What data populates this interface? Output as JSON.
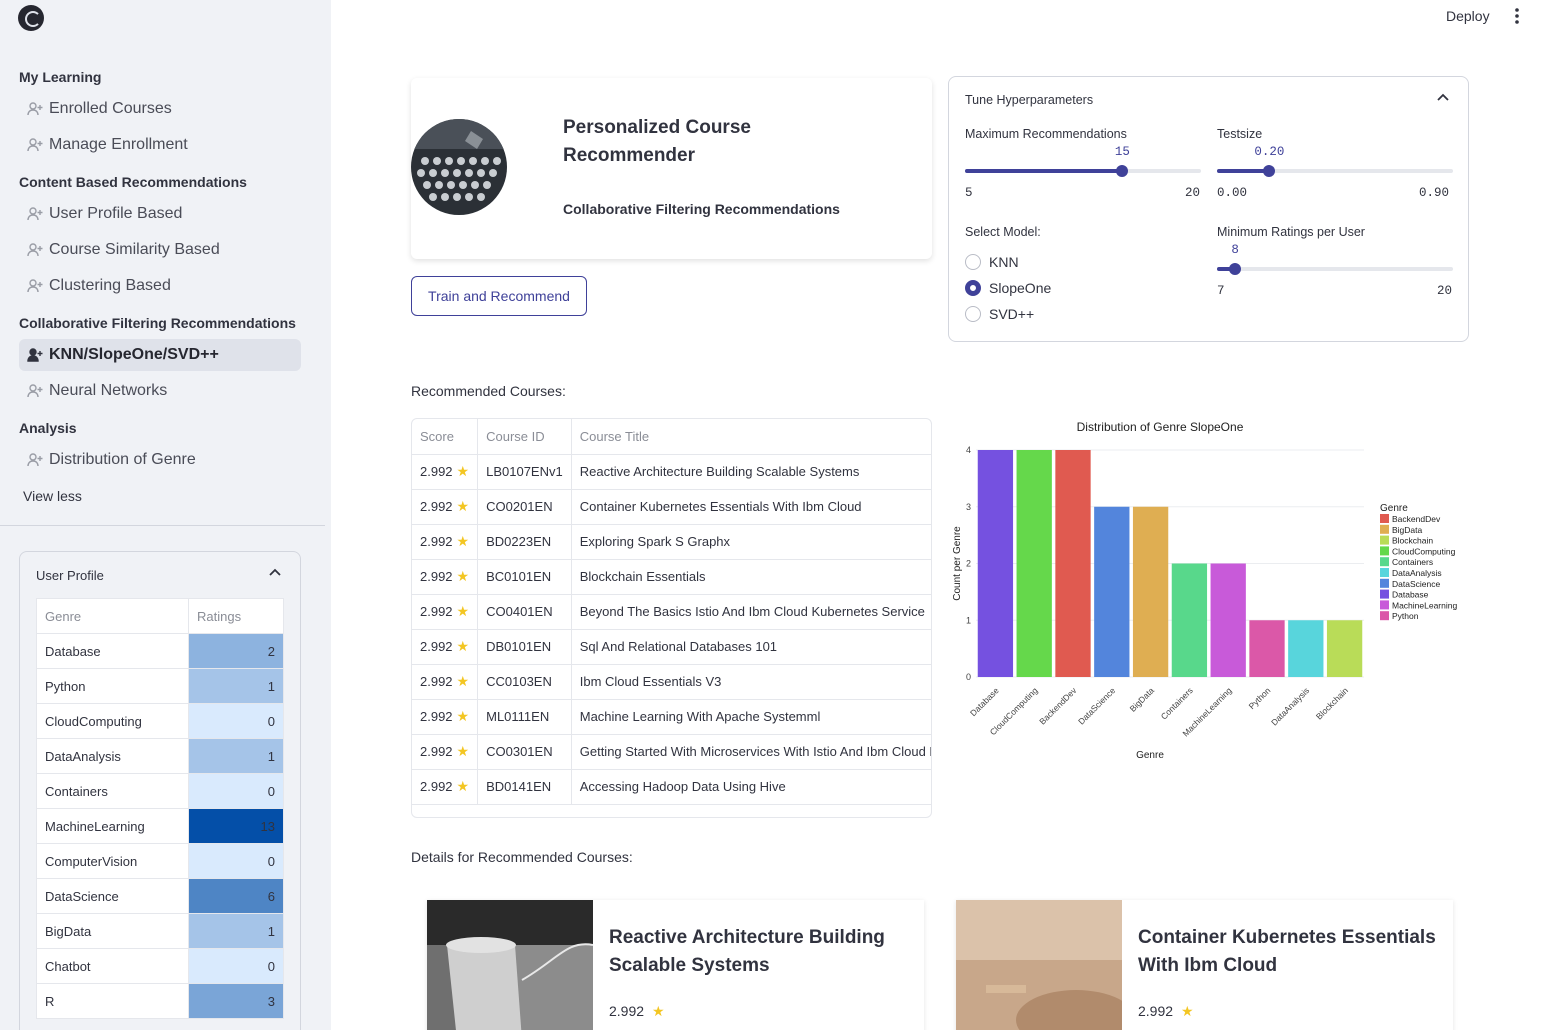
{
  "header": {
    "deploy_label": "Deploy",
    "menu_icon": "more-vertical-icon"
  },
  "sidebar": {
    "sections": [
      {
        "title": "My Learning",
        "items": [
          {
            "label": "Enrolled Courses"
          },
          {
            "label": "Manage Enrollment"
          }
        ]
      },
      {
        "title": "Content Based Recommendations",
        "items": [
          {
            "label": "User Profile Based"
          },
          {
            "label": "Course Similarity Based"
          },
          {
            "label": "Clustering Based"
          }
        ]
      },
      {
        "title": "Collaborative Filtering Recommendations",
        "items": [
          {
            "label": "KNN/SlopeOne/SVD++",
            "active": true
          },
          {
            "label": "Neural Networks"
          }
        ]
      },
      {
        "title": "Analysis",
        "items": [
          {
            "label": "Distribution of Genre"
          }
        ]
      }
    ],
    "view_less": "View less",
    "nav_icon": "user-plus-icon",
    "user_profile": {
      "title": "User Profile",
      "columns": [
        "Genre",
        "Ratings"
      ],
      "rows": [
        {
          "genre": "Database",
          "rating": 2
        },
        {
          "genre": "Python",
          "rating": 1
        },
        {
          "genre": "CloudComputing",
          "rating": 0
        },
        {
          "genre": "DataAnalysis",
          "rating": 1
        },
        {
          "genre": "Containers",
          "rating": 0
        },
        {
          "genre": "MachineLearning",
          "rating": 13
        },
        {
          "genre": "ComputerVision",
          "rating": 0
        },
        {
          "genre": "DataScience",
          "rating": 6
        },
        {
          "genre": "BigData",
          "rating": 1
        },
        {
          "genre": "Chatbot",
          "rating": 0
        },
        {
          "genre": "R",
          "rating": 3
        }
      ]
    }
  },
  "hero": {
    "title": "Personalized Course Recommender",
    "subtitle": "Collaborative Filtering Recommendations"
  },
  "train_button": "Train and Recommend",
  "hyperparameters": {
    "title": "Tune Hyperparameters",
    "max_recommendations": {
      "label": "Maximum Recommendations",
      "value": "15",
      "min": "5",
      "max": "20",
      "fraction": 0.667
    },
    "testsize": {
      "label": "Testsize",
      "value": "0.20",
      "min": "0.00",
      "max": "0.90",
      "fraction": 0.222
    },
    "select_model": {
      "label": "Select Model:",
      "options": [
        "KNN",
        "SlopeOne",
        "SVD++"
      ],
      "selected": "SlopeOne"
    },
    "min_ratings": {
      "label": "Minimum Ratings per User",
      "value": "8",
      "min": "7",
      "max": "20",
      "fraction": 0.077
    }
  },
  "recommended": {
    "heading": "Recommended Courses:",
    "columns": [
      "Score",
      "Course ID",
      "Course Title"
    ],
    "rows": [
      {
        "score": "2.992",
        "id": "LB0107ENv1",
        "title": "Reactive Architecture  Building Scalable Systems"
      },
      {
        "score": "2.992",
        "id": "CO0201EN",
        "title": "Container   Kubernetes Essentials With Ibm Cloud"
      },
      {
        "score": "2.992",
        "id": "BD0223EN",
        "title": "Exploring Spark S Graphx"
      },
      {
        "score": "2.992",
        "id": "BC0101EN",
        "title": "Blockchain Essentials"
      },
      {
        "score": "2.992",
        "id": "CO0401EN",
        "title": "Beyond The Basics  Istio And Ibm Cloud Kubernetes Service"
      },
      {
        "score": "2.992",
        "id": "DB0101EN",
        "title": "Sql And Relational Databases 101"
      },
      {
        "score": "2.992",
        "id": "CC0103EN",
        "title": "Ibm Cloud Essentials   V3"
      },
      {
        "score": "2.992",
        "id": "ML0111EN",
        "title": "Machine Learning With Apache Systemml"
      },
      {
        "score": "2.992",
        "id": "CO0301EN",
        "title": "Getting Started With Microservices With Istio And Ibm Cloud Kubernetes"
      },
      {
        "score": "2.992",
        "id": "BD0141EN",
        "title": "Accessing Hadoop Data Using Hive"
      }
    ]
  },
  "chart_data": {
    "type": "bar",
    "title": "Distribution of Genre SlopeOne",
    "xlabel": "Genre",
    "ylabel": "Count per Genre",
    "ylim": [
      0,
      4
    ],
    "yticks": [
      "0",
      "1",
      "2",
      "3",
      "4"
    ],
    "categories": [
      "Database",
      "CloudComputing",
      "BackendDev",
      "DataScience",
      "BigData",
      "Containers",
      "MachineLearning",
      "Python",
      "DataAnalysis",
      "Blockchain"
    ],
    "values": [
      4,
      4,
      4,
      3,
      3,
      2,
      2,
      1,
      1,
      1
    ],
    "colors": [
      "#7551e0",
      "#65d84b",
      "#e05a50",
      "#5385dc",
      "#dfae52",
      "#58d88b",
      "#c85ad9",
      "#db58a8",
      "#58d5dc",
      "#b9dc58"
    ],
    "legend_title": "Genre",
    "legend_position": "right",
    "legend": [
      {
        "name": "BackendDev",
        "color": "#e05a50"
      },
      {
        "name": "BigData",
        "color": "#dfae52"
      },
      {
        "name": "Blockchain",
        "color": "#b9dc58"
      },
      {
        "name": "CloudComputing",
        "color": "#65d84b"
      },
      {
        "name": "Containers",
        "color": "#58d88b"
      },
      {
        "name": "DataAnalysis",
        "color": "#58d5dc"
      },
      {
        "name": "DataScience",
        "color": "#5385dc"
      },
      {
        "name": "Database",
        "color": "#7551e0"
      },
      {
        "name": "MachineLearning",
        "color": "#c85ad9"
      },
      {
        "name": "Python",
        "color": "#db58a8"
      }
    ],
    "grid": true
  },
  "details": {
    "heading": "Details for Recommended Courses:",
    "cards": [
      {
        "title": "Reactive Architecture Building Scalable Systems",
        "score": "2.992"
      },
      {
        "title": "Container Kubernetes Essentials With Ibm Cloud",
        "score": "2.992"
      }
    ]
  },
  "theme": {
    "accent": "#3f4199",
    "star": "#f3c623"
  }
}
